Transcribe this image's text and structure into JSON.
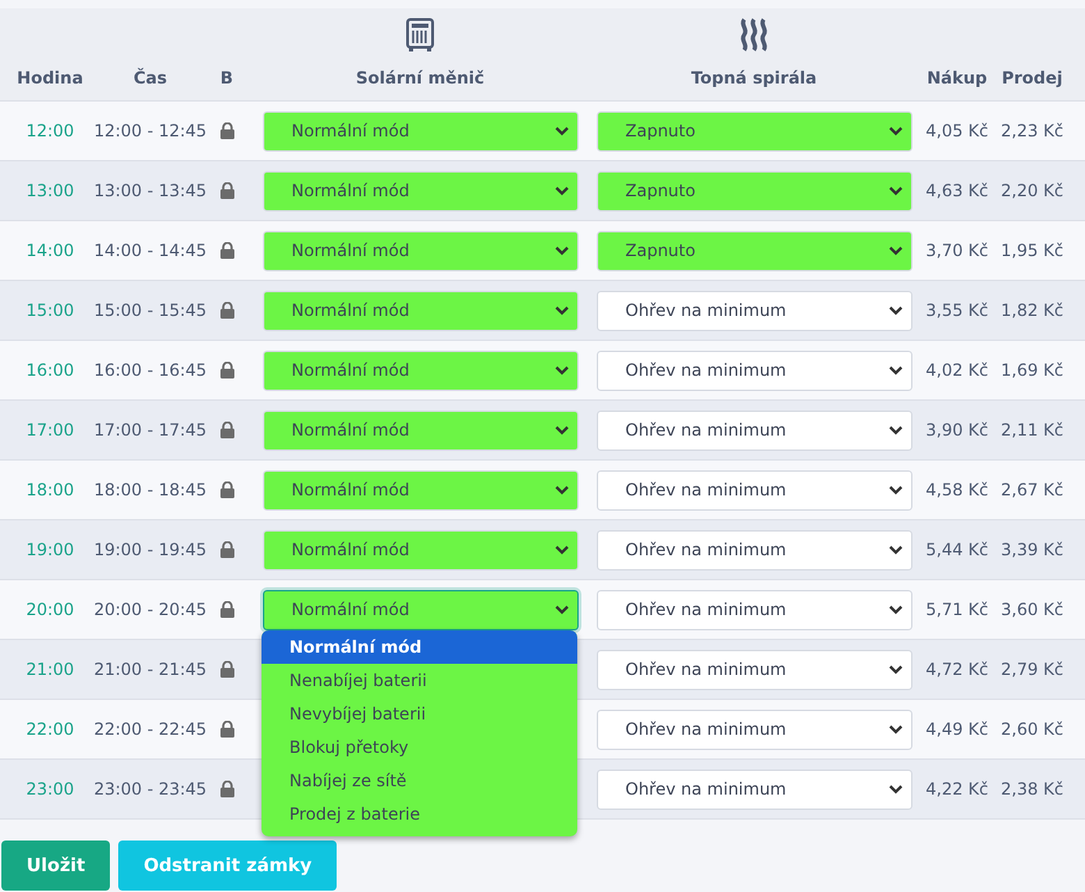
{
  "columns": [
    {
      "label": "Hodina"
    },
    {
      "label": "Čas"
    },
    {
      "label": "B"
    },
    {
      "label": "Solární měnič",
      "kind": "inverter"
    },
    {
      "label": "Topná spirála",
      "kind": "heater"
    },
    {
      "label": "Nákup"
    },
    {
      "label": "Prodej"
    }
  ],
  "rows": [
    {
      "hour": "12:00",
      "time": "12:00 - 12:45",
      "locked": true,
      "inverter": {
        "value": "Normální mód",
        "active": true,
        "open": false
      },
      "heater": {
        "value": "Zapnuto",
        "active": true
      },
      "buy": "4,05 Kč",
      "sell": "2,23 Kč"
    },
    {
      "hour": "13:00",
      "time": "13:00 - 13:45",
      "locked": true,
      "inverter": {
        "value": "Normální mód",
        "active": true,
        "open": false
      },
      "heater": {
        "value": "Zapnuto",
        "active": true
      },
      "buy": "4,63 Kč",
      "sell": "2,20 Kč"
    },
    {
      "hour": "14:00",
      "time": "14:00 - 14:45",
      "locked": true,
      "inverter": {
        "value": "Normální mód",
        "active": true,
        "open": false
      },
      "heater": {
        "value": "Zapnuto",
        "active": true
      },
      "buy": "3,70 Kč",
      "sell": "1,95 Kč"
    },
    {
      "hour": "15:00",
      "time": "15:00 - 15:45",
      "locked": true,
      "inverter": {
        "value": "Normální mód",
        "active": true,
        "open": false
      },
      "heater": {
        "value": "Ohřev na minimum",
        "active": false
      },
      "buy": "3,55 Kč",
      "sell": "1,82 Kč"
    },
    {
      "hour": "16:00",
      "time": "16:00 - 16:45",
      "locked": true,
      "inverter": {
        "value": "Normální mód",
        "active": true,
        "open": false
      },
      "heater": {
        "value": "Ohřev na minimum",
        "active": false
      },
      "buy": "4,02 Kč",
      "sell": "1,69 Kč"
    },
    {
      "hour": "17:00",
      "time": "17:00 - 17:45",
      "locked": true,
      "inverter": {
        "value": "Normální mód",
        "active": true,
        "open": false
      },
      "heater": {
        "value": "Ohřev na minimum",
        "active": false
      },
      "buy": "3,90 Kč",
      "sell": "2,11 Kč"
    },
    {
      "hour": "18:00",
      "time": "18:00 - 18:45",
      "locked": true,
      "inverter": {
        "value": "Normální mód",
        "active": true,
        "open": false
      },
      "heater": {
        "value": "Ohřev na minimum",
        "active": false
      },
      "buy": "4,58 Kč",
      "sell": "2,67 Kč"
    },
    {
      "hour": "19:00",
      "time": "19:00 - 19:45",
      "locked": true,
      "inverter": {
        "value": "Normální mód",
        "active": true,
        "open": false
      },
      "heater": {
        "value": "Ohřev na minimum",
        "active": false
      },
      "buy": "5,44 Kč",
      "sell": "3,39 Kč"
    },
    {
      "hour": "20:00",
      "time": "20:00 - 20:45",
      "locked": true,
      "inverter": {
        "value": "Normální mód",
        "active": true,
        "open": true,
        "options": [
          {
            "label": "Normální mód",
            "selected": true
          },
          {
            "label": "Nenabíjej baterii",
            "selected": false
          },
          {
            "label": "Nevybíjej baterii",
            "selected": false
          },
          {
            "label": "Blokuj přetoky",
            "selected": false
          },
          {
            "label": "Nabíjej ze sítě",
            "selected": false
          },
          {
            "label": "Prodej z baterie",
            "selected": false
          }
        ]
      },
      "heater": {
        "value": "Ohřev na minimum",
        "active": false
      },
      "buy": "5,71 Kč",
      "sell": "3,60 Kč"
    },
    {
      "hour": "21:00",
      "time": "21:00 - 21:45",
      "locked": true,
      "heater": {
        "value": "Ohřev na minimum",
        "active": false
      },
      "buy": "4,72 Kč",
      "sell": "2,79 Kč"
    },
    {
      "hour": "22:00",
      "time": "22:00 - 22:45",
      "locked": true,
      "heater": {
        "value": "Ohřev na minimum",
        "active": false
      },
      "buy": "4,49 Kč",
      "sell": "2,60 Kč"
    },
    {
      "hour": "23:00",
      "time": "23:00 - 23:45",
      "locked": true,
      "heater": {
        "value": "Ohřev na minimum",
        "active": false
      },
      "buy": "4,22 Kč",
      "sell": "2,38 Kč"
    }
  ],
  "buttons": [
    {
      "label": "Uložit",
      "kind": "primary"
    },
    {
      "label": "Odstranit zámky",
      "kind": "info"
    }
  ]
}
